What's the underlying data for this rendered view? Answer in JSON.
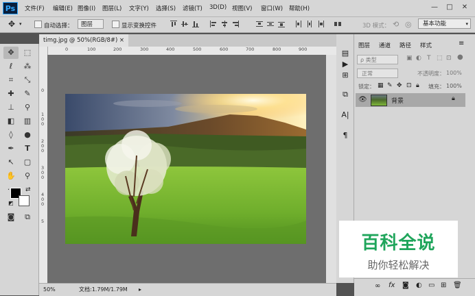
{
  "app": {
    "logo": "Ps"
  },
  "menu": [
    "文件(F)",
    "编辑(E)",
    "图像(I)",
    "图层(L)",
    "文字(Y)",
    "选择(S)",
    "滤镜(T)",
    "3D(D)",
    "视图(V)",
    "窗口(W)",
    "帮助(H)"
  ],
  "window_controls": {
    "minimize": "—",
    "restore": "□",
    "close": "✕"
  },
  "options": {
    "auto_select_label": "自动选择：",
    "auto_select_value": "图层",
    "show_transform_label": "显示变换控件",
    "mode_3d_label": "3D 模式：",
    "workspace": "基本功能"
  },
  "document": {
    "tab_title": "timg.jpg @ 50%(RGB/8#)",
    "tab_close": "×",
    "zoom": "50%",
    "doc_info": "文档:1.79M/1.79M"
  },
  "ruler": {
    "h": [
      "0",
      "100",
      "200",
      "300",
      "400",
      "500",
      "600",
      "700",
      "800",
      "900"
    ],
    "v": [
      "0",
      "1",
      "0",
      "0",
      "2",
      "0",
      "0",
      "3",
      "0",
      "0",
      "4",
      "0",
      "0",
      "5"
    ]
  },
  "panel": {
    "tabs": [
      "图层",
      "通道",
      "路径",
      "样式"
    ],
    "kind_label": "ρ 类型",
    "blend_mode": "正常",
    "opacity_label": "不透明度：",
    "opacity_value": "100%",
    "lock_label": "锁定：",
    "fill_label": "填充：",
    "fill_value": "100%",
    "layers": [
      {
        "name": "背景"
      }
    ]
  },
  "watermark": {
    "title": "百科全说",
    "subtitle": "助你轻松解决"
  },
  "colors": {
    "accent": "#31a8ff",
    "watermark_green": "#1fa55b"
  }
}
